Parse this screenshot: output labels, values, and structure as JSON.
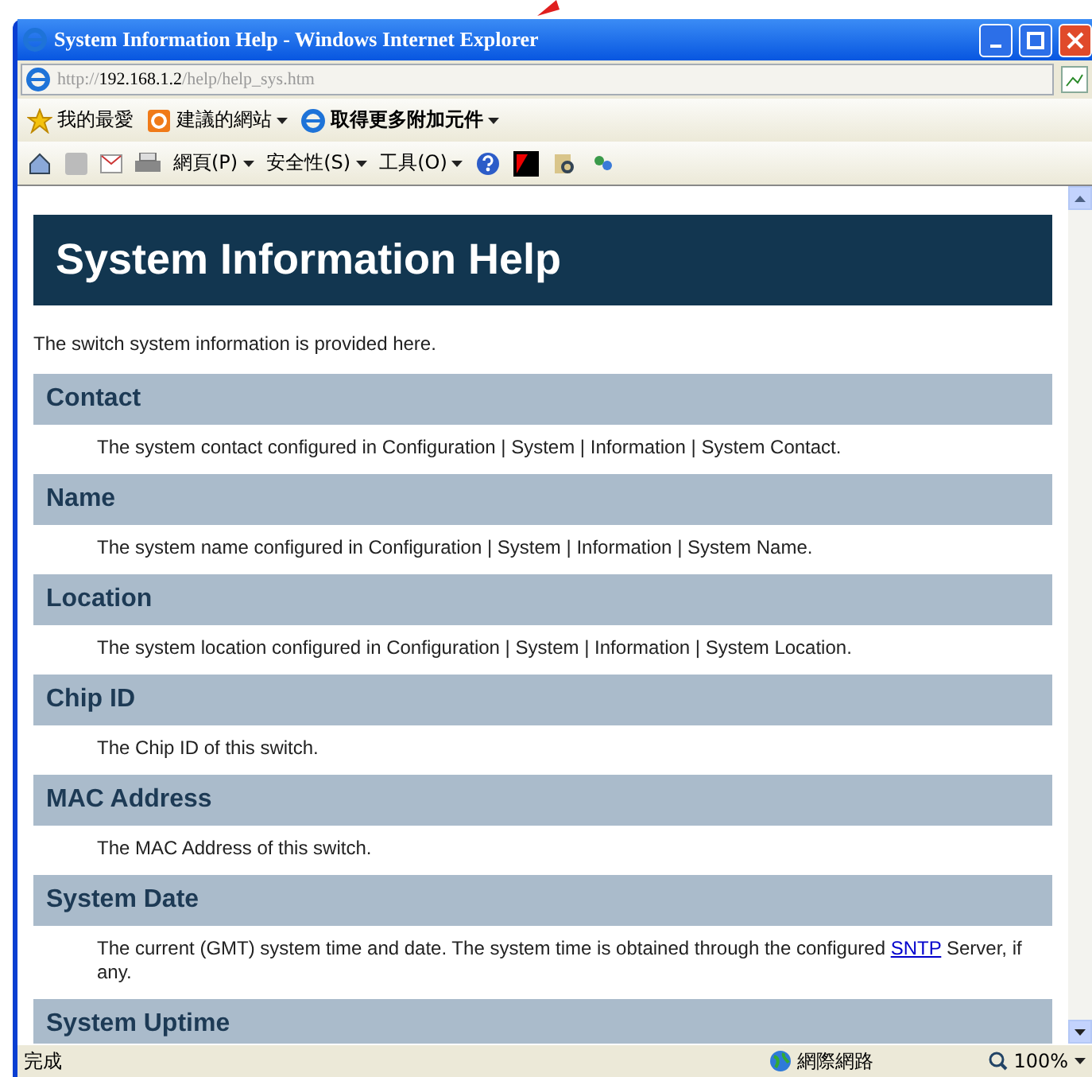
{
  "window": {
    "title": "System Information Help - Windows Internet Explorer"
  },
  "address_bar": {
    "url_prefix": "http://",
    "url_host": "192.168.1.2",
    "url_path": "/help/help_sys.htm"
  },
  "favorites_bar": [
    {
      "label": "我的最愛",
      "kind": "star",
      "dropdown": false
    },
    {
      "label": "建議的網站",
      "kind": "suggested",
      "dropdown": true
    },
    {
      "label": "取得更多附加元件",
      "kind": "addons",
      "dropdown": true
    }
  ],
  "command_bar": [
    {
      "label": "網頁(P)",
      "dropdown": true
    },
    {
      "label": "安全性(S)",
      "dropdown": true
    },
    {
      "label": "工具(O)",
      "dropdown": true
    }
  ],
  "page": {
    "title": "System Information Help",
    "intro": "The switch system information is provided here.",
    "sections": [
      {
        "heading": "Contact",
        "text": "The system contact configured in Configuration | System | Information | System Contact."
      },
      {
        "heading": "Name",
        "text": "The system name configured in Configuration | System | Information | System Name."
      },
      {
        "heading": "Location",
        "text": "The system location configured in Configuration | System | Information | System Location."
      },
      {
        "heading": "Chip ID",
        "text": "The Chip ID of this switch."
      },
      {
        "heading": "MAC Address",
        "text": "The MAC Address of this switch."
      },
      {
        "heading": "System Date",
        "text": "The current (GMT) system time and date. The system time is obtained through the configured",
        "link": "SNTP",
        "text_after": "Server, if any."
      },
      {
        "heading": "System Uptime"
      }
    ]
  },
  "status_bar": {
    "status": "完成",
    "zone": "網際網路",
    "zoom": "100%"
  }
}
